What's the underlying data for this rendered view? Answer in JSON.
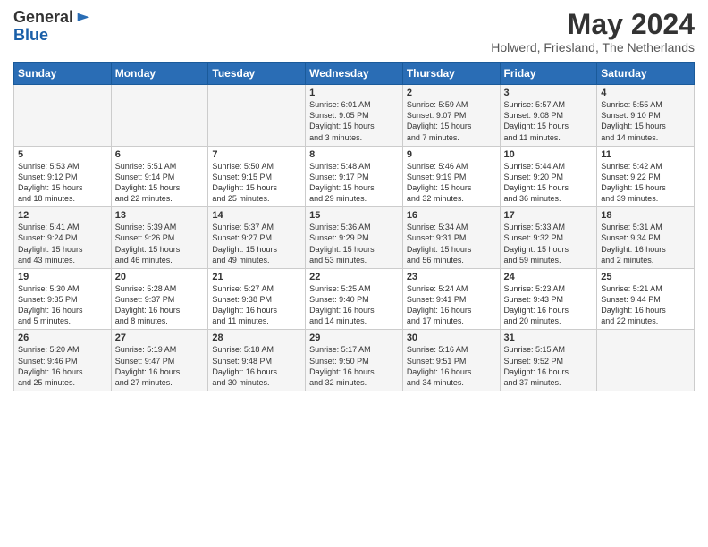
{
  "header": {
    "logo_general": "General",
    "logo_blue": "Blue",
    "month_year": "May 2024",
    "location": "Holwerd, Friesland, The Netherlands"
  },
  "days_of_week": [
    "Sunday",
    "Monday",
    "Tuesday",
    "Wednesday",
    "Thursday",
    "Friday",
    "Saturday"
  ],
  "weeks": [
    [
      {
        "day": "",
        "info": ""
      },
      {
        "day": "",
        "info": ""
      },
      {
        "day": "",
        "info": ""
      },
      {
        "day": "1",
        "info": "Sunrise: 6:01 AM\nSunset: 9:05 PM\nDaylight: 15 hours\nand 3 minutes."
      },
      {
        "day": "2",
        "info": "Sunrise: 5:59 AM\nSunset: 9:07 PM\nDaylight: 15 hours\nand 7 minutes."
      },
      {
        "day": "3",
        "info": "Sunrise: 5:57 AM\nSunset: 9:08 PM\nDaylight: 15 hours\nand 11 minutes."
      },
      {
        "day": "4",
        "info": "Sunrise: 5:55 AM\nSunset: 9:10 PM\nDaylight: 15 hours\nand 14 minutes."
      }
    ],
    [
      {
        "day": "5",
        "info": "Sunrise: 5:53 AM\nSunset: 9:12 PM\nDaylight: 15 hours\nand 18 minutes."
      },
      {
        "day": "6",
        "info": "Sunrise: 5:51 AM\nSunset: 9:14 PM\nDaylight: 15 hours\nand 22 minutes."
      },
      {
        "day": "7",
        "info": "Sunrise: 5:50 AM\nSunset: 9:15 PM\nDaylight: 15 hours\nand 25 minutes."
      },
      {
        "day": "8",
        "info": "Sunrise: 5:48 AM\nSunset: 9:17 PM\nDaylight: 15 hours\nand 29 minutes."
      },
      {
        "day": "9",
        "info": "Sunrise: 5:46 AM\nSunset: 9:19 PM\nDaylight: 15 hours\nand 32 minutes."
      },
      {
        "day": "10",
        "info": "Sunrise: 5:44 AM\nSunset: 9:20 PM\nDaylight: 15 hours\nand 36 minutes."
      },
      {
        "day": "11",
        "info": "Sunrise: 5:42 AM\nSunset: 9:22 PM\nDaylight: 15 hours\nand 39 minutes."
      }
    ],
    [
      {
        "day": "12",
        "info": "Sunrise: 5:41 AM\nSunset: 9:24 PM\nDaylight: 15 hours\nand 43 minutes."
      },
      {
        "day": "13",
        "info": "Sunrise: 5:39 AM\nSunset: 9:26 PM\nDaylight: 15 hours\nand 46 minutes."
      },
      {
        "day": "14",
        "info": "Sunrise: 5:37 AM\nSunset: 9:27 PM\nDaylight: 15 hours\nand 49 minutes."
      },
      {
        "day": "15",
        "info": "Sunrise: 5:36 AM\nSunset: 9:29 PM\nDaylight: 15 hours\nand 53 minutes."
      },
      {
        "day": "16",
        "info": "Sunrise: 5:34 AM\nSunset: 9:31 PM\nDaylight: 15 hours\nand 56 minutes."
      },
      {
        "day": "17",
        "info": "Sunrise: 5:33 AM\nSunset: 9:32 PM\nDaylight: 15 hours\nand 59 minutes."
      },
      {
        "day": "18",
        "info": "Sunrise: 5:31 AM\nSunset: 9:34 PM\nDaylight: 16 hours\nand 2 minutes."
      }
    ],
    [
      {
        "day": "19",
        "info": "Sunrise: 5:30 AM\nSunset: 9:35 PM\nDaylight: 16 hours\nand 5 minutes."
      },
      {
        "day": "20",
        "info": "Sunrise: 5:28 AM\nSunset: 9:37 PM\nDaylight: 16 hours\nand 8 minutes."
      },
      {
        "day": "21",
        "info": "Sunrise: 5:27 AM\nSunset: 9:38 PM\nDaylight: 16 hours\nand 11 minutes."
      },
      {
        "day": "22",
        "info": "Sunrise: 5:25 AM\nSunset: 9:40 PM\nDaylight: 16 hours\nand 14 minutes."
      },
      {
        "day": "23",
        "info": "Sunrise: 5:24 AM\nSunset: 9:41 PM\nDaylight: 16 hours\nand 17 minutes."
      },
      {
        "day": "24",
        "info": "Sunrise: 5:23 AM\nSunset: 9:43 PM\nDaylight: 16 hours\nand 20 minutes."
      },
      {
        "day": "25",
        "info": "Sunrise: 5:21 AM\nSunset: 9:44 PM\nDaylight: 16 hours\nand 22 minutes."
      }
    ],
    [
      {
        "day": "26",
        "info": "Sunrise: 5:20 AM\nSunset: 9:46 PM\nDaylight: 16 hours\nand 25 minutes."
      },
      {
        "day": "27",
        "info": "Sunrise: 5:19 AM\nSunset: 9:47 PM\nDaylight: 16 hours\nand 27 minutes."
      },
      {
        "day": "28",
        "info": "Sunrise: 5:18 AM\nSunset: 9:48 PM\nDaylight: 16 hours\nand 30 minutes."
      },
      {
        "day": "29",
        "info": "Sunrise: 5:17 AM\nSunset: 9:50 PM\nDaylight: 16 hours\nand 32 minutes."
      },
      {
        "day": "30",
        "info": "Sunrise: 5:16 AM\nSunset: 9:51 PM\nDaylight: 16 hours\nand 34 minutes."
      },
      {
        "day": "31",
        "info": "Sunrise: 5:15 AM\nSunset: 9:52 PM\nDaylight: 16 hours\nand 37 minutes."
      },
      {
        "day": "",
        "info": ""
      }
    ]
  ]
}
